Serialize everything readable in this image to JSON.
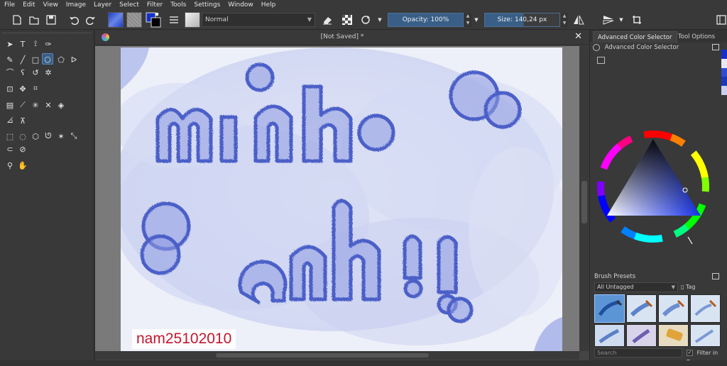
{
  "menu": [
    "File",
    "Edit",
    "View",
    "Image",
    "Layer",
    "Select",
    "Filter",
    "Tools",
    "Settings",
    "Window",
    "Help"
  ],
  "toolbar": {
    "blend_mode": "Normal",
    "opacity_label": "Opacity: 100%",
    "size_label": "Size: 140,24 px"
  },
  "document": {
    "title": "[Not Saved]  *",
    "watermark": "nam25102010"
  },
  "dock": {
    "tab_active": "Advanced Color Selector",
    "tab_other": "Tool Options",
    "panel_title": "Advanced Color Selector",
    "presets_title": "Brush Presets",
    "presets_filter": "All Untagged",
    "tag_label": "Tag",
    "search_placeholder": "Search",
    "filter_in_tag": "Filter in Tag"
  },
  "colors": {
    "accent": "#3a5f86",
    "ink_blue": "#4b5fc8",
    "foreground": "#1530c8",
    "background": "#000000"
  }
}
